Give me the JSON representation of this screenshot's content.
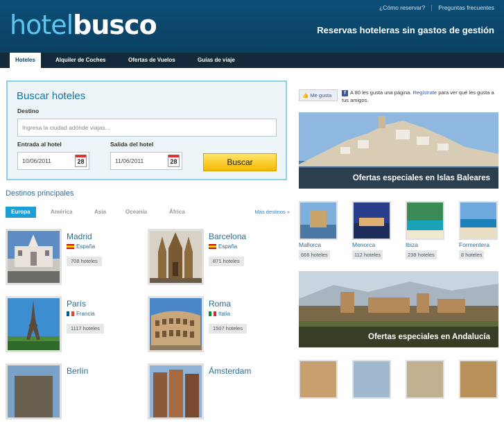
{
  "header": {
    "logo_hotel": "hotel",
    "logo_busco": "busco",
    "links": [
      "¿Cómo reservar?",
      "Preguntas frecuentes"
    ],
    "tagline": "Reservas hoteleras sin gastos de gestión"
  },
  "nav": {
    "tabs": [
      "Hoteles",
      "Alquiler de Coches",
      "Ofertas de Vuelos",
      "Guías de viaje"
    ],
    "active": "Hoteles"
  },
  "search": {
    "title": "Buscar hoteles",
    "dest_label": "Destino",
    "dest_placeholder": "Ingresa la ciudad adónde viajas...",
    "checkin_label": "Entrada al hotel",
    "checkin_value": "10/06/2011",
    "checkout_label": "Salida del hotel",
    "checkout_value": "11/06/2011",
    "calendar_day": "28",
    "button": "Buscar"
  },
  "destinations": {
    "title": "Destinos principales",
    "regions": [
      "Europa",
      "América",
      "Asia",
      "Oceanía",
      "África"
    ],
    "active_region": "Europa",
    "more": "Más destinos »",
    "cities": [
      {
        "name": "Madrid",
        "country": "España",
        "count": "708 hoteles",
        "flag": "es"
      },
      {
        "name": "Barcelona",
        "country": "España",
        "count": "871 hoteles",
        "flag": "es"
      },
      {
        "name": "París",
        "country": "Francia",
        "count": "1117 hoteles",
        "flag": "fr"
      },
      {
        "name": "Roma",
        "country": "Italia",
        "count": "1507 hoteles",
        "flag": "it"
      },
      {
        "name": "Berlín",
        "country": "",
        "count": "",
        "flag": ""
      },
      {
        "name": "Ámsterdam",
        "country": "",
        "count": "",
        "flag": ""
      }
    ]
  },
  "facebook": {
    "like": "Me gusta",
    "text_before": "A 80 les gusta una página.",
    "register": "Regístrate",
    "text_after": "para ver qué les gusta a tus amigos."
  },
  "offers": [
    {
      "caption": "Ofertas especiales en Islas Baleares",
      "items": [
        {
          "name": "Mallorca",
          "count": "666 hoteles"
        },
        {
          "name": "Menorca",
          "count": "112 hoteles"
        },
        {
          "name": "Ibiza",
          "count": "238 hoteles"
        },
        {
          "name": "Formentera",
          "count": "8 hoteles"
        }
      ]
    },
    {
      "caption": "Ofertas especiales en Andalucía",
      "items": []
    }
  ],
  "colors": {
    "header": "#0d4f78",
    "nav": "#122a3a",
    "accent": "#1b9fd7",
    "button": "#f5b800"
  }
}
